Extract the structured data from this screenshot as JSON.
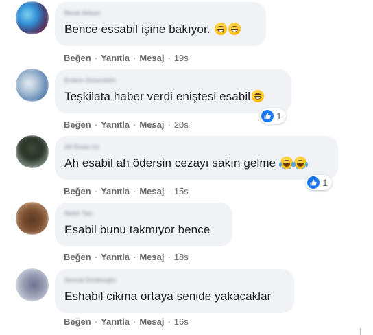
{
  "actions": {
    "like": "Beğen",
    "reply": "Yanıtla",
    "message": "Mesaj",
    "separator": "·"
  },
  "comments": [
    {
      "author": "Berat Akkan",
      "text": "Bence essabil işine bakıyor.",
      "emojis": [
        "grinning-face-with-smiling-eyes",
        "grinning-face-with-smiling-eyes"
      ],
      "time": "19s",
      "reaction_count": ""
    },
    {
      "author": "Erdem Güvenbilir",
      "text": "Teşkilata haber verdi eniştesi esabil",
      "emojis": [
        "grinning-face-with-big-eyes"
      ],
      "time": "20s",
      "reaction_count": "1"
    },
    {
      "author": "Ali İhsan Uz",
      "text": "Ah esabil ah ödersin cezayı sakın gelme",
      "emojis": [
        "face-with-tears-of-joy",
        "face-with-tears-of-joy"
      ],
      "time": "15s",
      "reaction_count": "1"
    },
    {
      "author": "Nehir Tan",
      "text": "Esabil bunu takmıyor bence",
      "emojis": [],
      "time": "18s",
      "reaction_count": ""
    },
    {
      "author": "Sevval Doldaoglu",
      "text": "Eshabil cikma ortaya senide yakacaklar",
      "emojis": [],
      "time": "16s",
      "reaction_count": ""
    }
  ],
  "colors": {
    "bubble": "#f0f2f5",
    "meta_text": "#65676b",
    "like_blue": "#1877f2"
  }
}
